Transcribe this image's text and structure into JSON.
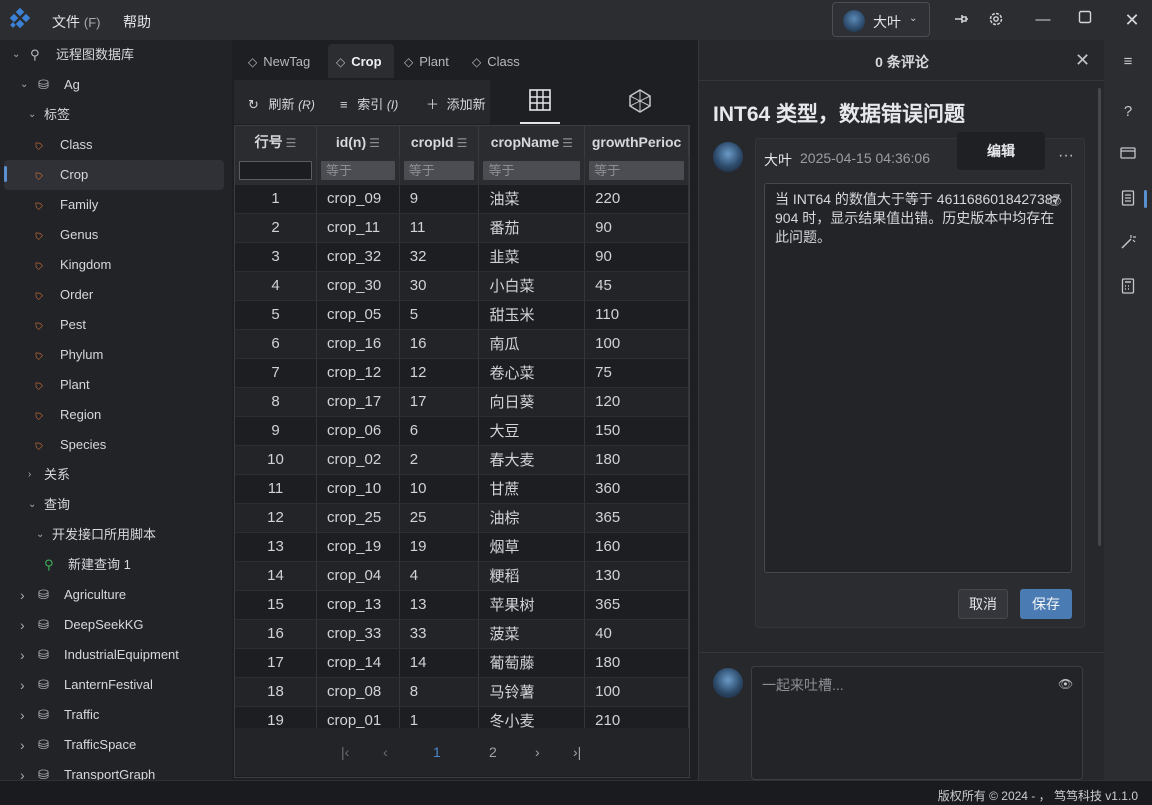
{
  "menu": {
    "file": "文件",
    "file_shortcut": "(F)",
    "help": "帮助"
  },
  "user": {
    "name": "大叶"
  },
  "sidebar": {
    "remote_db": "远程图数据库",
    "db_ag": "Ag",
    "tags_group": "标签",
    "tags": [
      "Class",
      "Crop",
      "Family",
      "Genus",
      "Kingdom",
      "Order",
      "Pest",
      "Phylum",
      "Plant",
      "Region",
      "Species"
    ],
    "relations_group": "关系",
    "queries_group": "查询",
    "query_folder": "开发接口所用脚本",
    "query_item": "新建查询 1",
    "databases": [
      "Agriculture",
      "DeepSeekKG",
      "IndustrialEquipment",
      "LanternFestival",
      "Traffic",
      "TrafficSpace",
      "TransportGraph"
    ]
  },
  "tabs": [
    "NewTag",
    "Crop",
    "Plant",
    "Class"
  ],
  "toolbar": {
    "refresh": "刷新",
    "refresh_key": "(R)",
    "index": "索引",
    "index_key": "(I)",
    "add": "添加新"
  },
  "table": {
    "columns": [
      "行号",
      "id(n)",
      "cropId",
      "cropName",
      "growthPerioc"
    ],
    "filter_placeholder": "等于",
    "rows": [
      [
        "1",
        "crop_09",
        "9",
        "油菜",
        "220"
      ],
      [
        "2",
        "crop_11",
        "11",
        "番茄",
        "90"
      ],
      [
        "3",
        "crop_32",
        "32",
        "韭菜",
        "90"
      ],
      [
        "4",
        "crop_30",
        "30",
        "小白菜",
        "45"
      ],
      [
        "5",
        "crop_05",
        "5",
        "甜玉米",
        "110"
      ],
      [
        "6",
        "crop_16",
        "16",
        "南瓜",
        "100"
      ],
      [
        "7",
        "crop_12",
        "12",
        "卷心菜",
        "75"
      ],
      [
        "8",
        "crop_17",
        "17",
        "向日葵",
        "120"
      ],
      [
        "9",
        "crop_06",
        "6",
        "大豆",
        "150"
      ],
      [
        "10",
        "crop_02",
        "2",
        "春大麦",
        "180"
      ],
      [
        "11",
        "crop_10",
        "10",
        "甘蔗",
        "360"
      ],
      [
        "12",
        "crop_25",
        "25",
        "油棕",
        "365"
      ],
      [
        "13",
        "crop_19",
        "19",
        "烟草",
        "160"
      ],
      [
        "14",
        "crop_04",
        "4",
        "粳稻",
        "130"
      ],
      [
        "15",
        "crop_13",
        "13",
        "苹果树",
        "365"
      ],
      [
        "16",
        "crop_33",
        "33",
        "菠菜",
        "40"
      ],
      [
        "17",
        "crop_14",
        "14",
        "葡萄藤",
        "180"
      ],
      [
        "18",
        "crop_08",
        "8",
        "马铃薯",
        "100"
      ],
      [
        "19",
        "crop_01",
        "1",
        "冬小麦",
        "210"
      ]
    ]
  },
  "pager": {
    "current": "1",
    "next": "2"
  },
  "comments": {
    "header": "0 条评论",
    "issue_title": "INT64 类型，数据错误问题",
    "author": "大叶",
    "time": "2025-04-15 04:36:06",
    "edit_tooltip": "编辑",
    "more": "···",
    "body": "当 INT64 的数值大于等于 4611686018427387904 时，显示结果值出错。历史版本中均存在此问题。",
    "cancel": "取消",
    "save": "保存",
    "new_placeholder": "一起来吐槽..."
  },
  "status": {
    "copyright": "版权所有 © 2024 - ，  笃笃科技  v1.1.0"
  }
}
